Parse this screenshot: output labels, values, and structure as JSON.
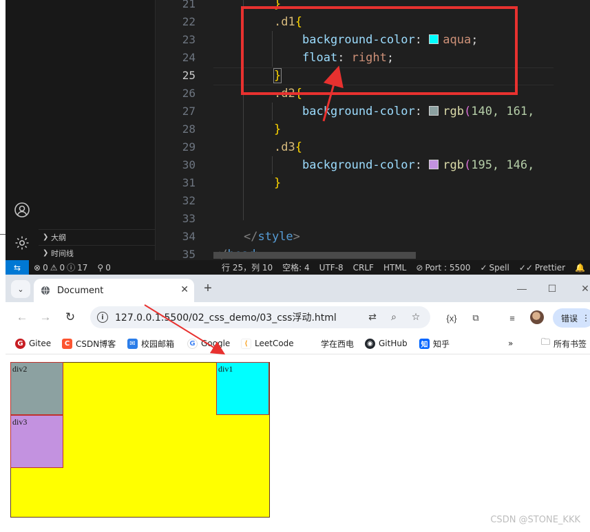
{
  "editor": {
    "line_numbers": [
      "21",
      "22",
      "23",
      "24",
      "25",
      "26",
      "27",
      "28",
      "29",
      "30",
      "31",
      "32",
      "33",
      "34",
      "35"
    ],
    "active_line": "25",
    "outline": [
      {
        "label": "大纲"
      },
      {
        "label": "时间线"
      }
    ],
    "code": {
      "l21": "}",
      "l22_sel": ".d1",
      "l22_brace": "{",
      "l23_prop": "background-color",
      "l23_val": "aqua",
      "l24_prop": "float",
      "l24_val": "right",
      "l25": "}",
      "l26_sel": ".d2",
      "l26_brace": "{",
      "l27_prop": "background-color",
      "l27_fn": "rgb",
      "l27_args": "140, 161,",
      "l28": "}",
      "l29_sel": ".d3",
      "l29_brace": "{",
      "l30_prop": "background-color",
      "l30_fn": "rgb",
      "l30_args": "195, 146,",
      "l31": "}",
      "l34_tag": "style",
      "l35_tag": "head"
    },
    "swatches": {
      "aqua": "#00ffff",
      "d2": "#8ca1a1",
      "d3": "#c392e0"
    }
  },
  "statusbar": {
    "problems": "0",
    "warnings": "0",
    "info": "17",
    "ports": "0",
    "cursor": "行 25，列 10",
    "spaces": "空格: 4",
    "encoding": "UTF-8",
    "eol": "CRLF",
    "language": "HTML",
    "port": "Port : 5500",
    "spell": "Spell",
    "prettier": "Prettier"
  },
  "browser": {
    "tab_title": "Document",
    "url": "127.0.0.1:5500/02_css_demo/03_css浮动.html",
    "error_label": "错误",
    "bookmarks": [
      {
        "label": "Gitee"
      },
      {
        "label": "CSDN博客"
      },
      {
        "label": "校园邮箱"
      },
      {
        "label": "Google"
      },
      {
        "label": "LeetCode"
      },
      {
        "label": "学在西电"
      },
      {
        "label": "GitHub"
      },
      {
        "label": "知乎"
      }
    ],
    "all_bookmarks": "所有书签"
  },
  "page": {
    "div1": "div1",
    "div2": "div2",
    "div3": "div3",
    "colors": {
      "container": "#ffff00",
      "div1": "#00ffff",
      "div2": "#8ca1a1",
      "div3": "#c392e0"
    }
  },
  "watermark": "CSDN @STONE_KKK"
}
